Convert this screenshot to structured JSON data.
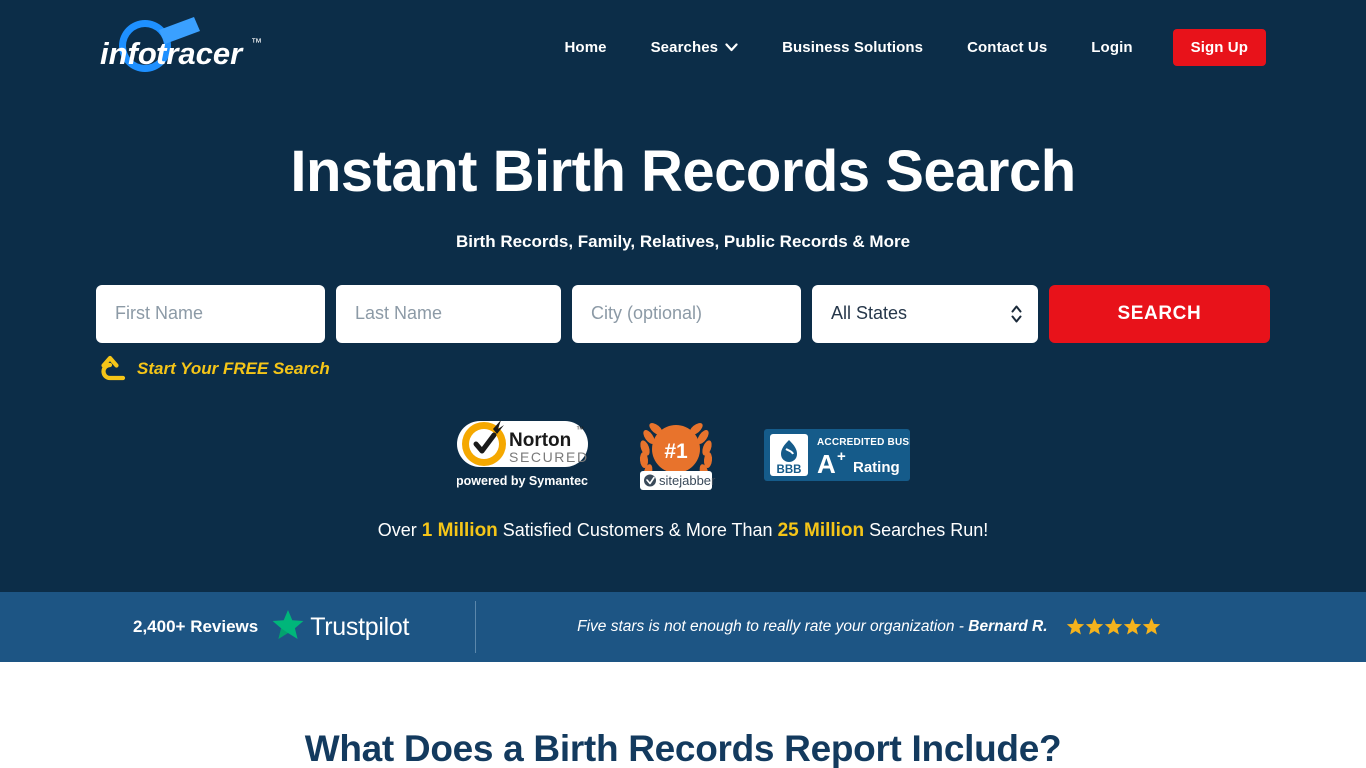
{
  "header": {
    "logo": {
      "word1": "info",
      "word2": "tracer",
      "tm": "™",
      "name": "infotracer-logo"
    },
    "nav": [
      {
        "label": "Home",
        "name": "nav-home"
      },
      {
        "label": "Searches",
        "name": "nav-searches",
        "icon": "chevron-down-icon"
      },
      {
        "label": "Business Solutions",
        "name": "nav-business-solutions"
      },
      {
        "label": "Contact Us",
        "name": "nav-contact-us"
      },
      {
        "label": "Login",
        "name": "nav-login"
      }
    ],
    "signup_label": "Sign Up",
    "signup_color": "#e8121a"
  },
  "hero": {
    "headline": "Instant Birth Records Search",
    "subhead": "Birth Records, Family, Relatives, Public Records & More",
    "background_color": "#0c2d48",
    "search": {
      "first_name_placeholder": "First Name",
      "first_name_value": "",
      "last_name_placeholder": "Last Name",
      "last_name_value": "",
      "city_placeholder": "City (optional)",
      "city_value": "",
      "state_selected": "All States",
      "state_options": [
        "All States"
      ],
      "search_label": "SEARCH",
      "search_color": "#e8121a"
    },
    "free_search_label": "Start Your FREE Search",
    "free_search_color": "#f5c518",
    "badges": [
      {
        "name": "norton-secured-badge",
        "title": "Norton",
        "subtitle": "SECURED",
        "tm": "™",
        "footer": "powered by Symantec"
      },
      {
        "name": "sitejabber-badge",
        "rank": "#1",
        "label": "sitejabber"
      },
      {
        "name": "bbb-badge",
        "acronym": "BBB",
        "line1": "ACCREDITED BUSINESS",
        "grade": "A",
        "grade_sup": "+",
        "rating_word": "Rating"
      }
    ],
    "stats": {
      "prefix": "Over ",
      "highlight1": "1 Million",
      "middle": " Satisfied Customers & More Than ",
      "highlight2": "25 Million",
      "suffix": " Searches Run!",
      "highlight_color": "#f5c518"
    }
  },
  "trustpilot": {
    "reviews_count": "2,400+ Reviews",
    "brand": "Trustpilot",
    "star_color": "#00b67a",
    "quote": "Five stars is not enough to really rate your organization - ",
    "reviewer": "Bernard R.",
    "rating_stars": 5,
    "rating_star_color": "#f5b31d",
    "background_color": "#1d5584"
  },
  "content_section": {
    "title": "What Does a Birth Records Report Include?",
    "title_color": "#133a5e"
  }
}
